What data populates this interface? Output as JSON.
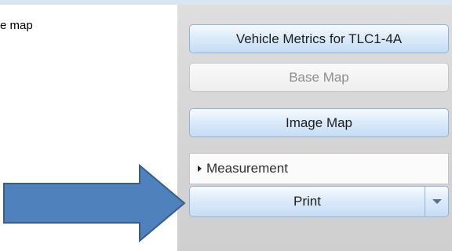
{
  "page": {
    "text_fragment": "e map"
  },
  "panel": {
    "vehicle_metrics_label": "Vehicle Metrics for TLC1-4A",
    "base_map_label": "Base Map",
    "image_map_label": "Image Map",
    "measurement_label": "Measurement",
    "print_label": "Print"
  },
  "colors": {
    "button_blue": "#dcebfa",
    "button_border": "#8fb4d8",
    "panel_gray": "#d8d8d8",
    "arrow_fill": "#4f81bd",
    "arrow_stroke": "#385d8a"
  }
}
